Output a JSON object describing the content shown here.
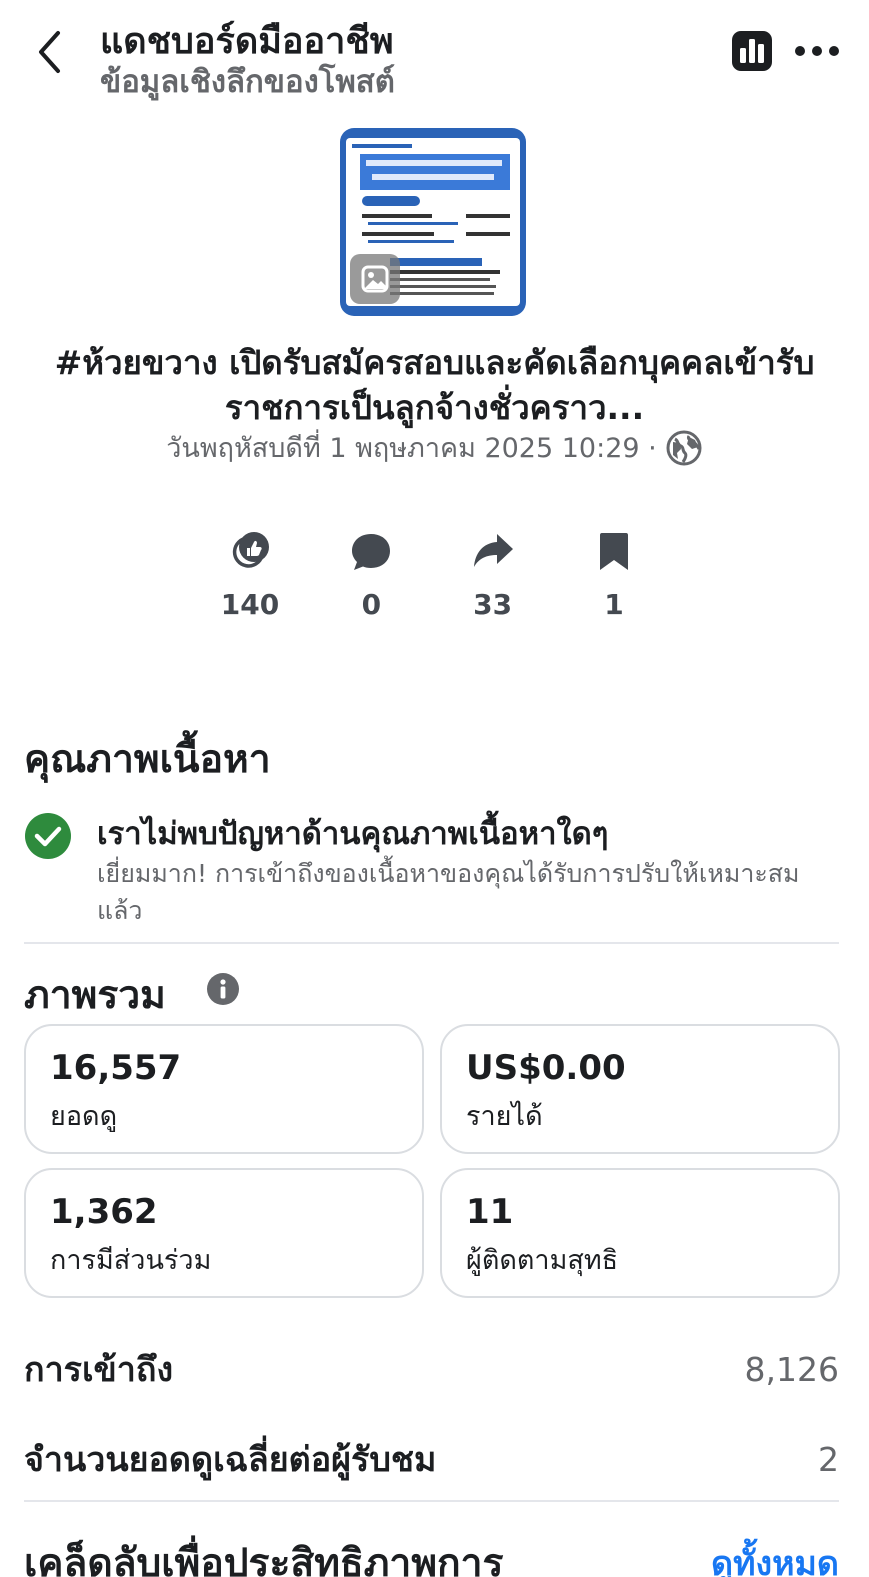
{
  "header": {
    "title": "แดชบอร์ดมืออาชีพ",
    "subtitle": "ข้อมูลเชิงลึกของโพสต์",
    "back_icon": "chevron-left-icon",
    "chart_icon": "bar-chart-icon",
    "more_icon": "more-horizontal-icon"
  },
  "post": {
    "thumbnail_icon": "photo-media-icon",
    "title": "#ห้วยขวาง เปิดรับสมัครสอบและคัดเลือกบุคคลเข้ารับราชการเป็นลูกจ้างชั่วคราว...",
    "date": "วันพฤหัสบดีที่ 1 พฤษภาคม  2025 10:29 ·",
    "privacy_icon": "globe-icon"
  },
  "engagement": [
    {
      "icon": "reactions-icon",
      "value": "140"
    },
    {
      "icon": "comment-icon",
      "value": "0"
    },
    {
      "icon": "share-icon",
      "value": "33"
    },
    {
      "icon": "bookmark-icon",
      "value": "1"
    }
  ],
  "quality": {
    "heading": "คุณภาพเนื้อหา",
    "status_title": "เราไม่พบปัญหาด้านคุณภาพเนื้อหาใดๆ",
    "status_desc": "เยี่ยมมาก! การเข้าถึงของเนื้อหาของคุณได้รับการปรับให้เหมาะสมแล้ว",
    "status_color": "#2e8b3d"
  },
  "overview": {
    "heading": "ภาพรวม",
    "cards": [
      {
        "value": "16,557",
        "label": "ยอดดู"
      },
      {
        "value": "US$0.00",
        "label": "รายได้"
      },
      {
        "value": "1,362",
        "label": "การมีส่วนร่วม"
      },
      {
        "value": "11",
        "label": "ผู้ติดตามสุทธิ"
      }
    ],
    "rows": [
      {
        "label": "การเข้าถึง",
        "value": "8,126"
      },
      {
        "label": "จำนวนยอดดูเฉลี่ยต่อผู้รับชม",
        "value": "2"
      }
    ]
  },
  "tips": {
    "heading": "เคล็ดลับเพื่อประสิทธิภาพการ",
    "see_all": "ดูทั้งหมด"
  }
}
